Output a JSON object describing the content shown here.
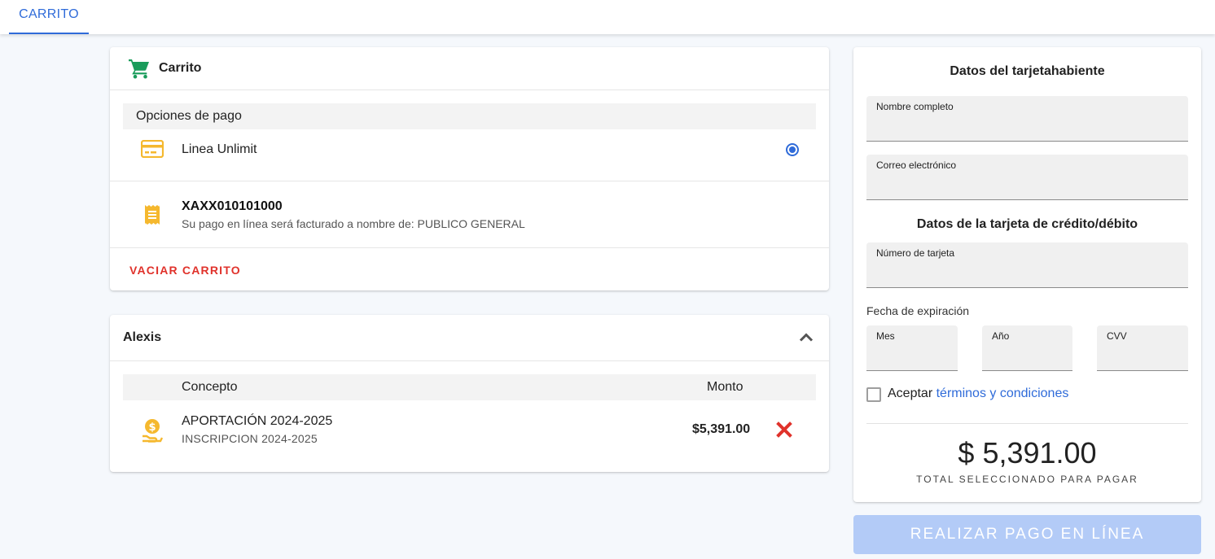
{
  "tabs": [
    {
      "label": "CARRITO",
      "active": true
    }
  ],
  "cart": {
    "title": "Carrito",
    "payment_options_title": "Opciones de pago",
    "payment_option": {
      "label": "Linea Unlimit",
      "selected": true
    },
    "invoice": {
      "rfc": "XAXX010101000",
      "note": "Su pago en línea será facturado a nombre de: PUBLICO GENERAL"
    },
    "empty_label": "VACIAR CARRITO"
  },
  "student": {
    "name": "Alexis",
    "columns": {
      "concept": "Concepto",
      "amount": "Monto"
    },
    "items": [
      {
        "title": "APORTACIÓN 2024-2025",
        "subtitle": "INSCRIPCION 2024-2025",
        "amount": "$5,391.00"
      }
    ]
  },
  "payment_form": {
    "cardholder_title": "Datos del tarjetahabiente",
    "full_name_label": "Nombre completo",
    "email_label": "Correo electrónico",
    "card_title": "Datos de la tarjeta de crédito/débito",
    "card_number_label": "Número de tarjeta",
    "expiry_label": "Fecha de expiración",
    "month_label": "Mes",
    "year_label": "Año",
    "cvv_label": "CVV",
    "accept_text": "Aceptar",
    "terms_link": "términos y condiciones",
    "terms_checked": false,
    "total": "$ 5,391.00",
    "total_caption": "TOTAL SELECCIONADO PARA PAGAR"
  },
  "pay_button": {
    "label": "REALIZAR PAGO EN LÍNEA",
    "enabled": false
  },
  "colors": {
    "accent": "#2f6bd9",
    "cart_icon": "#1a9c5b",
    "warning_icon": "#f5b82e",
    "danger": "#e0322b",
    "disabled_button": "#b3cbf7"
  },
  "icons": {
    "cart": "shopping-cart-icon",
    "card": "credit-card-icon",
    "receipt": "receipt-icon",
    "coin": "coin-hand-icon",
    "collapse": "chevron-up-icon",
    "remove": "close-icon"
  }
}
